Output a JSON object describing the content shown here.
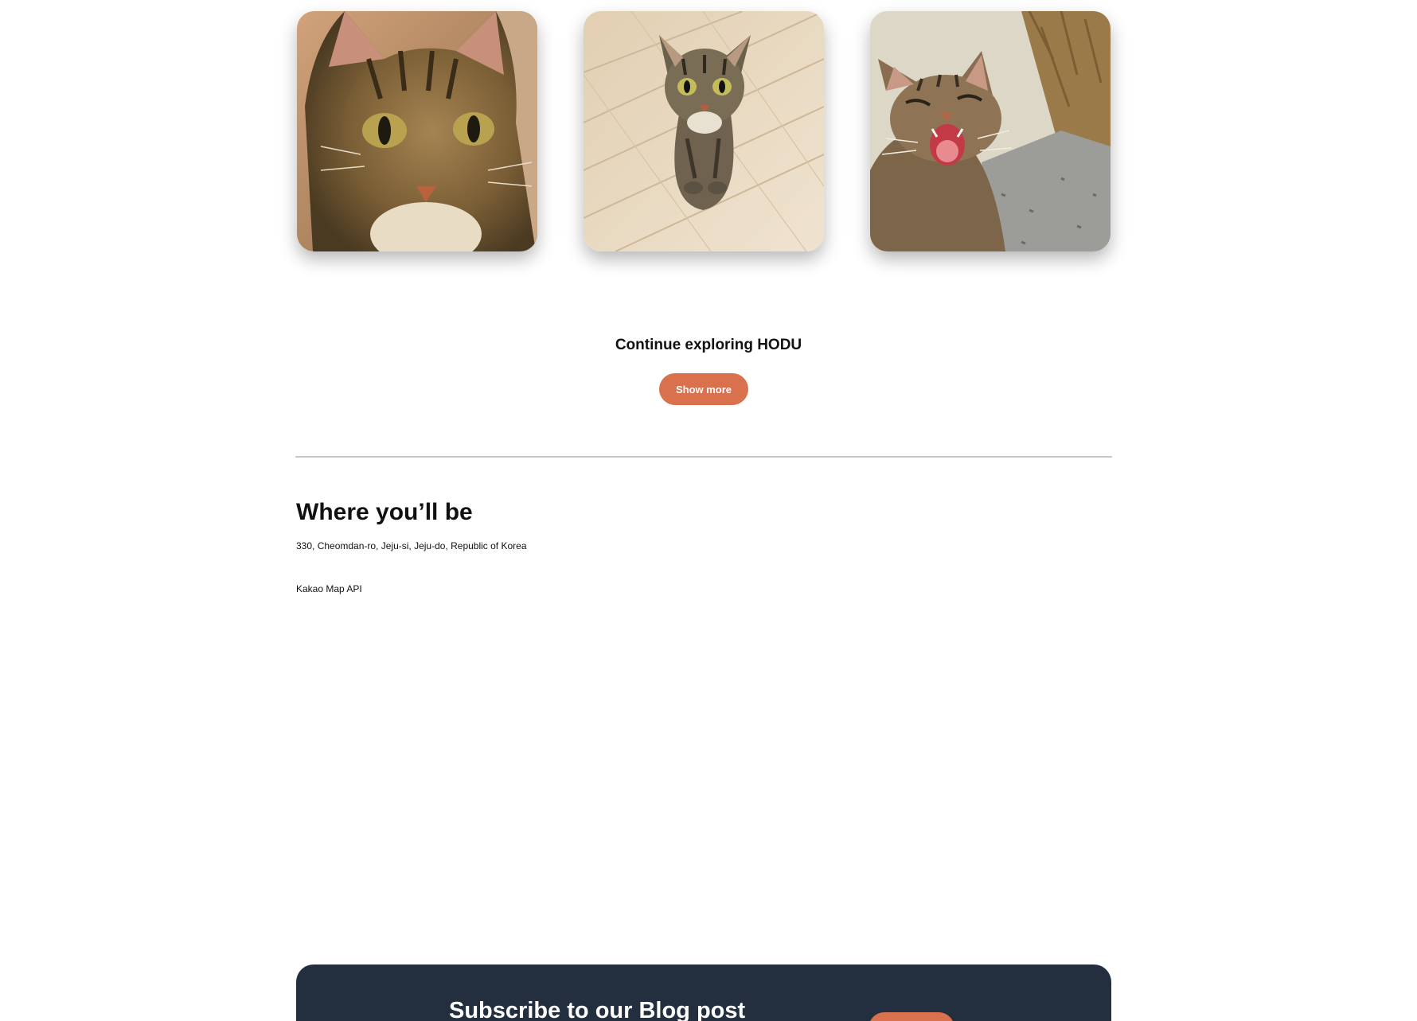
{
  "gallery": {
    "photos": [
      {
        "alt": "Cat close-up portrait",
        "icon": "cat-photo"
      },
      {
        "alt": "Cat looking up from wooden floor",
        "icon": "cat-photo"
      },
      {
        "alt": "Cat yawning in the sun",
        "icon": "cat-photo"
      }
    ]
  },
  "explore": {
    "title": "Continue exploring HODU",
    "button_label": "Show more"
  },
  "location": {
    "heading": "Where you’ll be",
    "address": "330, Cheomdan-ro, Jeju-si, Jeju-do, Republic of Korea",
    "map_label": "Kakao Map API"
  },
  "subscribe": {
    "title": "Subscribe to our Blog post",
    "button_label": ""
  },
  "colors": {
    "accent": "#d9714f",
    "dark_panel": "#232f3e",
    "divider": "#c7c7c7"
  }
}
